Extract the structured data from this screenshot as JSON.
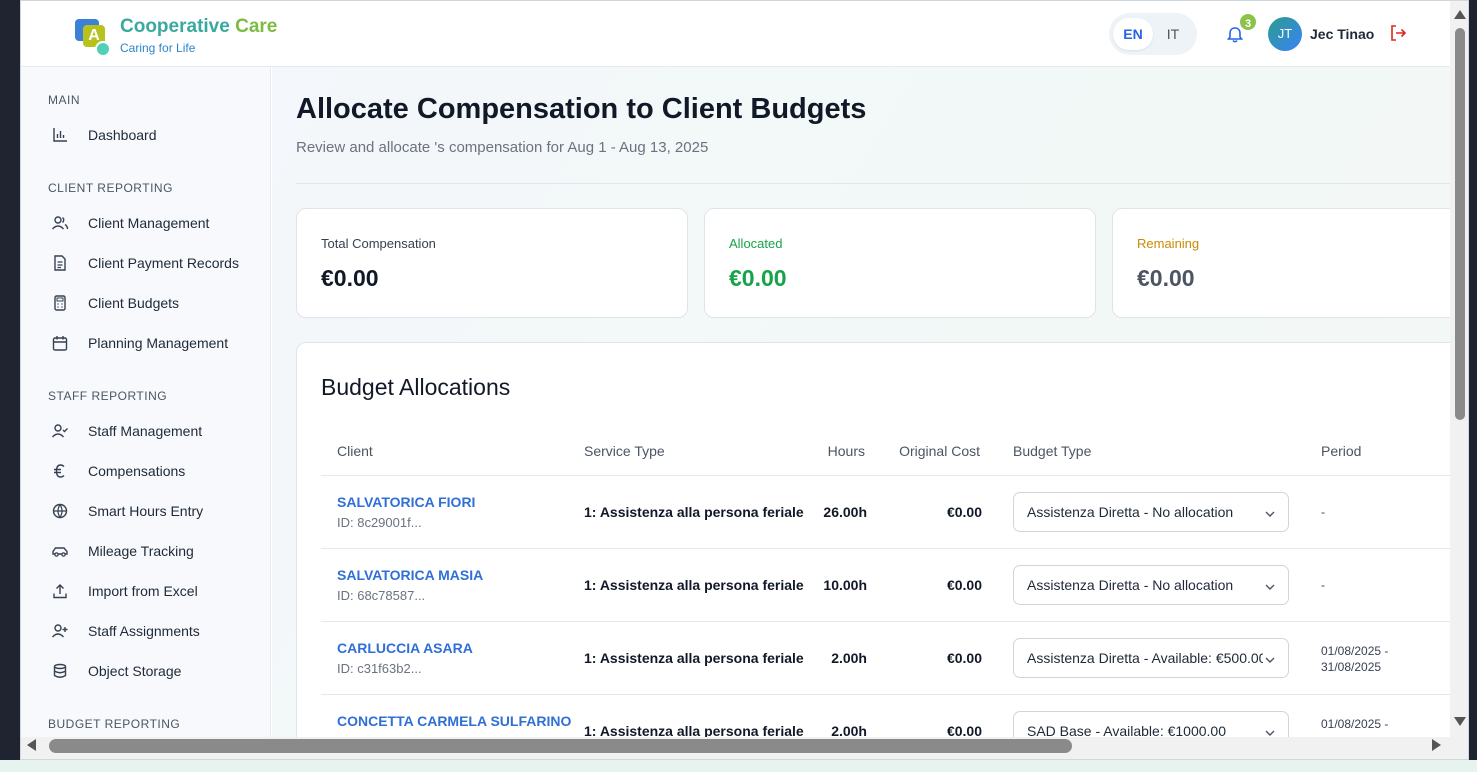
{
  "brand": {
    "title_part1": "Cooperative",
    "title_part2": "Care",
    "tagline": "Caring for Life",
    "logo_letter": "A"
  },
  "header": {
    "lang_en": "EN",
    "lang_it": "IT",
    "notification_count": "3",
    "user_initials": "JT",
    "user_name": "Jec Tinao"
  },
  "sidebar": {
    "sections": [
      {
        "title": "MAIN",
        "items": [
          {
            "label": "Dashboard",
            "icon": "bar-chart-icon"
          }
        ]
      },
      {
        "title": "CLIENT REPORTING",
        "items": [
          {
            "label": "Client Management",
            "icon": "users-icon"
          },
          {
            "label": "Client Payment Records",
            "icon": "document-icon"
          },
          {
            "label": "Client Budgets",
            "icon": "calculator-icon"
          },
          {
            "label": "Planning Management",
            "icon": "calendar-icon"
          }
        ]
      },
      {
        "title": "STAFF REPORTING",
        "items": [
          {
            "label": "Staff Management",
            "icon": "user-check-icon"
          },
          {
            "label": "Compensations",
            "icon": "euro-icon"
          },
          {
            "label": "Smart Hours Entry",
            "icon": "globe-icon"
          },
          {
            "label": "Mileage Tracking",
            "icon": "car-icon"
          },
          {
            "label": "Import from Excel",
            "icon": "upload-icon"
          },
          {
            "label": "Staff Assignments",
            "icon": "user-plus-icon"
          },
          {
            "label": "Object Storage",
            "icon": "database-icon"
          }
        ]
      },
      {
        "title": "BUDGET REPORTING",
        "items": []
      }
    ]
  },
  "page": {
    "title": "Allocate Compensation to Client Budgets",
    "subtitle": "Review and allocate 's compensation for Aug 1 - Aug 13, 2025"
  },
  "summary": {
    "total_label": "Total Compensation",
    "total_value": "€0.00",
    "allocated_label": "Allocated",
    "allocated_value": "€0.00",
    "remaining_label": "Remaining",
    "remaining_value": "€0.00",
    "colors": {
      "allocated": "#16a34a",
      "remaining": "#ca8a04"
    }
  },
  "allocations": {
    "title": "Budget Allocations",
    "columns": [
      "Client",
      "Service Type",
      "Hours",
      "Original Cost",
      "Budget Type",
      "Period"
    ],
    "rows": [
      {
        "client": "SALVATORICA FIORI",
        "id": "ID: 8c29001f...",
        "service": "1: Assistenza alla persona feriale",
        "hours": "26.00h",
        "cost": "€0.00",
        "budget": "Assistenza Diretta - No allocation",
        "period1": "-",
        "period2": ""
      },
      {
        "client": "SALVATORICA MASIA",
        "id": "ID: 68c78587...",
        "service": "1: Assistenza alla persona feriale",
        "hours": "10.00h",
        "cost": "€0.00",
        "budget": "Assistenza Diretta - No allocation",
        "period1": "-",
        "period2": ""
      },
      {
        "client": "CARLUCCIA ASARA",
        "id": "ID: c31f63b2...",
        "service": "1: Assistenza alla persona feriale",
        "hours": "2.00h",
        "cost": "€0.00",
        "budget": "Assistenza Diretta - Available: €500.00",
        "period1": "01/08/2025 -",
        "period2": "31/08/2025"
      },
      {
        "client": "CONCETTA CARMELA SULFARINO",
        "id": "",
        "service": "1: Assistenza alla persona feriale",
        "hours": "2.00h",
        "cost": "€0.00",
        "budget": "SAD Base - Available: €1000.00",
        "period1": "01/08/2025 -",
        "period2": ""
      }
    ]
  }
}
